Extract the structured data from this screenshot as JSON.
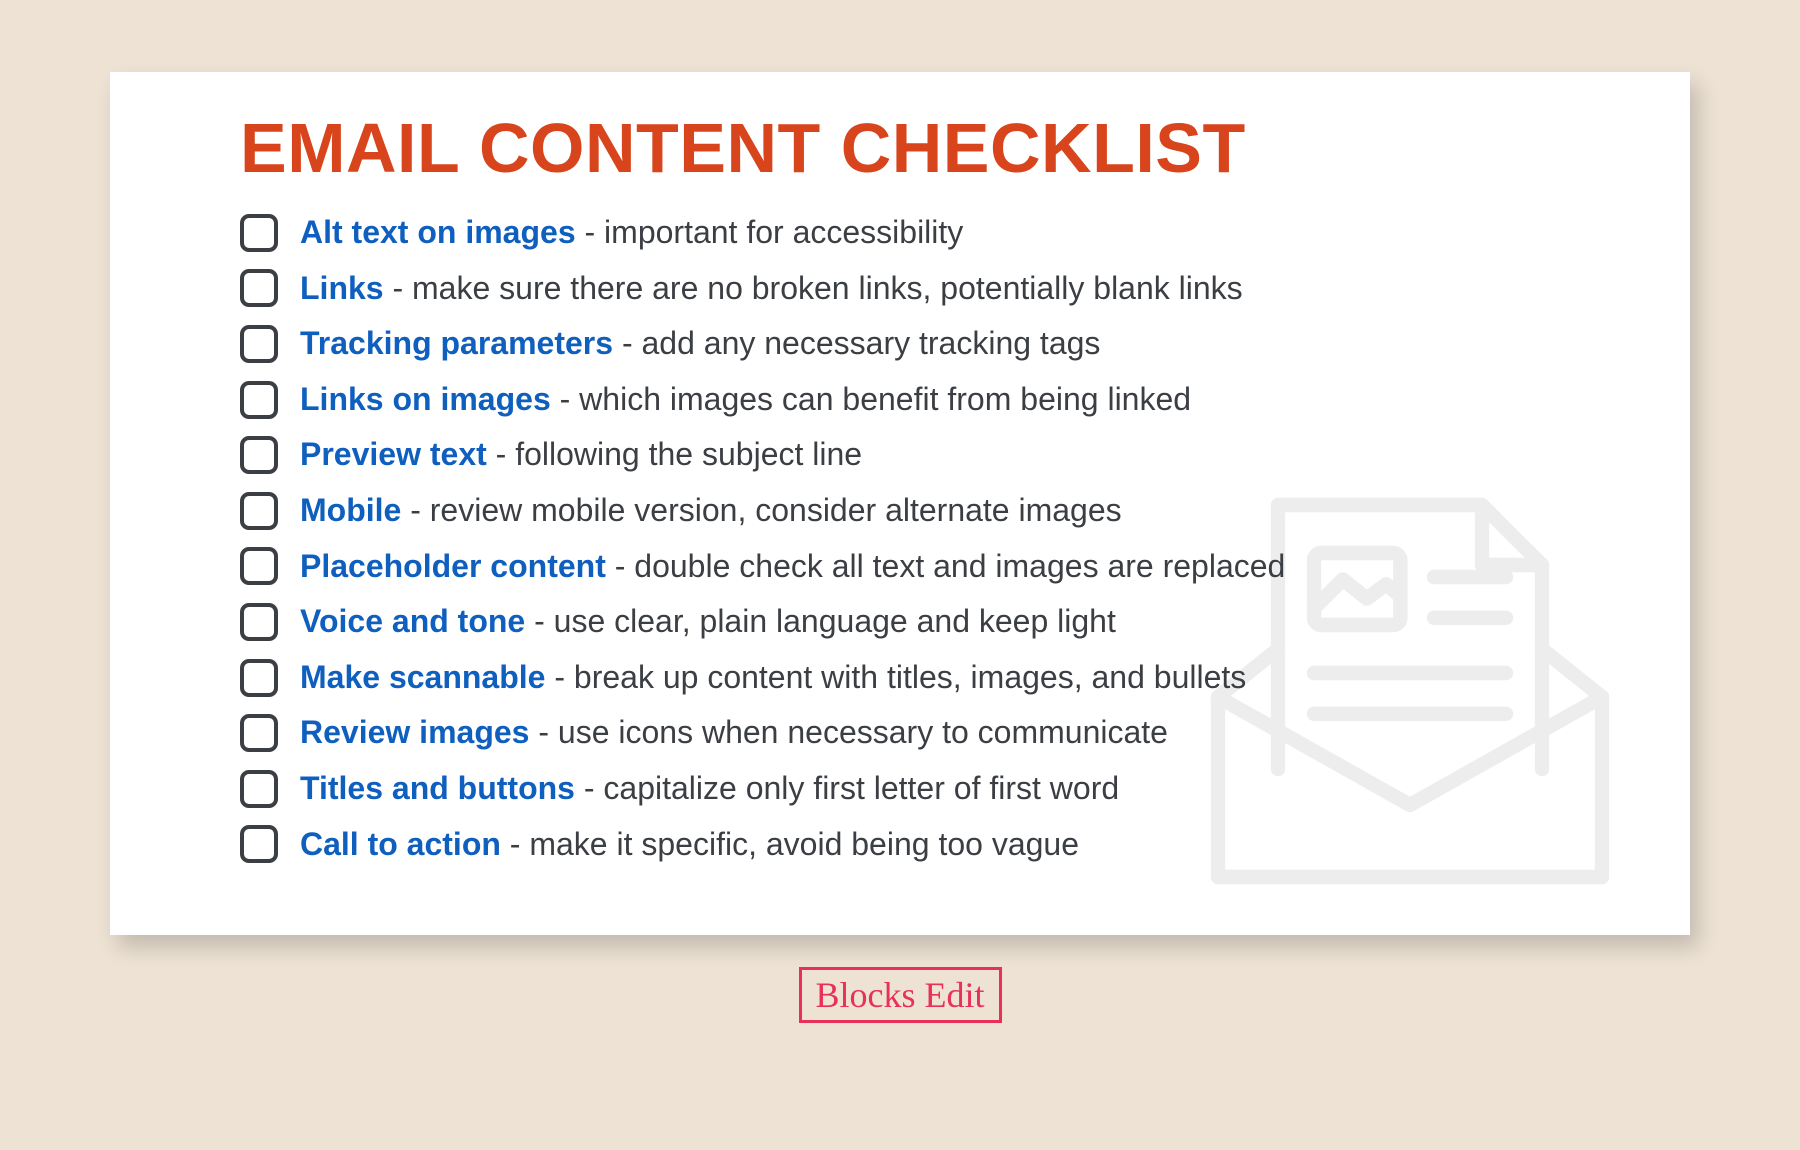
{
  "title": "EMAIL CONTENT CHECKLIST",
  "items": [
    {
      "title": "Alt text on images",
      "desc": "important for accessibility"
    },
    {
      "title": "Links",
      "desc": "make sure there are no broken links, potentially blank links"
    },
    {
      "title": "Tracking parameters",
      "desc": "add any necessary tracking tags"
    },
    {
      "title": "Links on images",
      "desc": "which images can benefit from being linked"
    },
    {
      "title": "Preview text",
      "desc": "following the subject line"
    },
    {
      "title": "Mobile",
      "desc": "review mobile version, consider alternate images"
    },
    {
      "title": "Placeholder content",
      "desc": "double check all text and images are replaced"
    },
    {
      "title": "Voice and tone",
      "desc": "use clear, plain language and keep light"
    },
    {
      "title": "Make scannable",
      "desc": "break up content with titles, images, and bullets"
    },
    {
      "title": "Review images",
      "desc": "use icons when necessary to communicate"
    },
    {
      "title": "Titles and buttons",
      "desc": "capitalize only first letter of first word"
    },
    {
      "title": "Call to action",
      "desc": "make it specific, avoid being too vague"
    }
  ],
  "footer": "Blocks Edit"
}
